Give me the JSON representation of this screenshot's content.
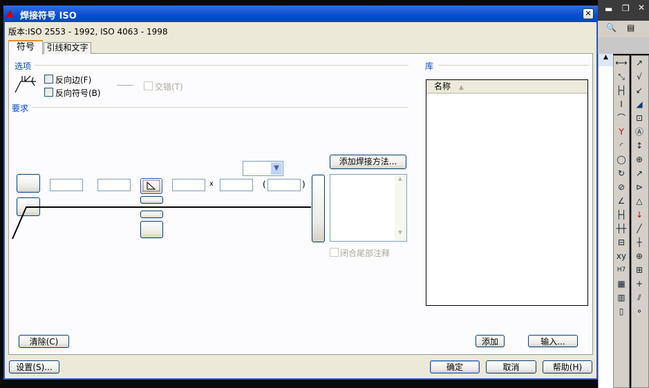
{
  "title": "焊接符号 ISO",
  "version": "版本:ISO 2553 - 1992, ISO 4063 - 1998",
  "tabs": [
    {
      "label": "符号"
    },
    {
      "label": "引线和文字"
    }
  ],
  "options": {
    "legend": "选项",
    "reverse_side": "反向边(F)",
    "reverse_symbol": "反向符号(B)",
    "stagger": "交错(T)"
  },
  "requirements": {
    "legend": "要求",
    "times": "x",
    "paren_open": "(",
    "paren_close": ")",
    "add_method": "添加焊接方法...",
    "close_tail": "闭合尾部注释"
  },
  "library": {
    "legend": "库",
    "column": "名称",
    "add": "添加",
    "import": "输入..."
  },
  "clear": "清除(C)",
  "footer": {
    "settings": "设置(S)...",
    "ok": "确定",
    "cancel": "取消",
    "help": "帮助(H)"
  },
  "colors": {
    "accent": "#0a4cd0",
    "legend": "#0046d5"
  }
}
